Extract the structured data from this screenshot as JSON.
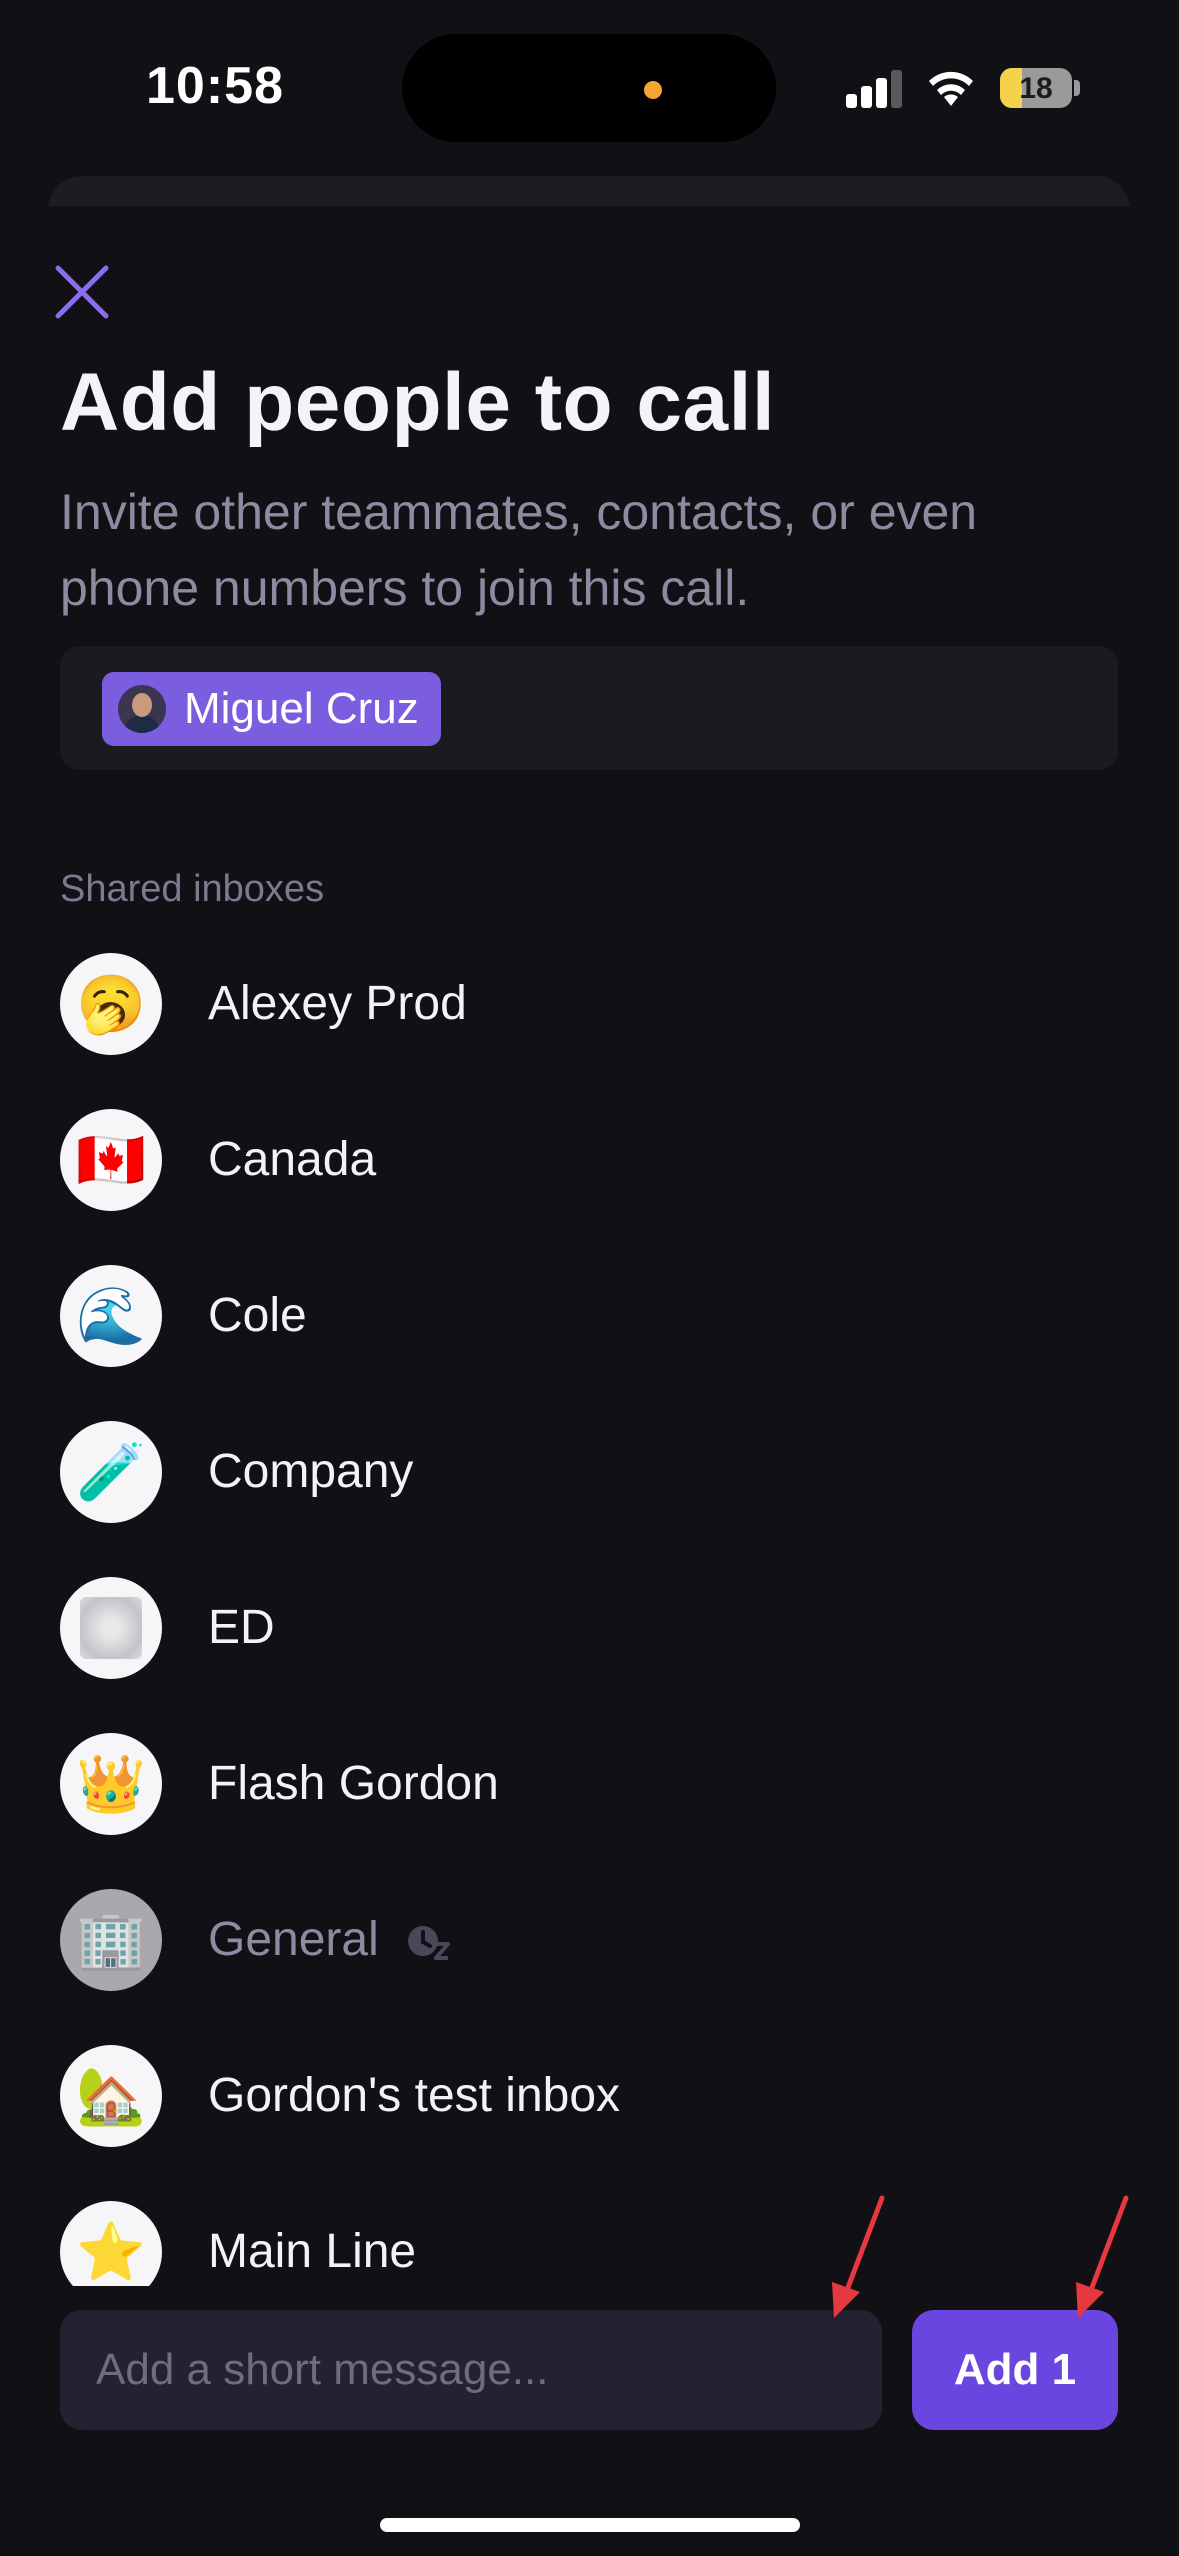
{
  "status_bar": {
    "time": "10:58",
    "battery": "18",
    "island_indicator_color": "#f6a531"
  },
  "header": {
    "close_icon": "close-icon",
    "title": "Add people to call",
    "subtitle": "Invite other teammates, contacts, or even phone numbers to join this call."
  },
  "recipients": [
    {
      "name": "Miguel Cruz"
    }
  ],
  "section": {
    "label": "Shared inboxes"
  },
  "inboxes": [
    {
      "name": "Alexey Prod",
      "emoji": "🥱",
      "muted": false
    },
    {
      "name": "Canada",
      "emoji": "🇨🇦",
      "muted": false
    },
    {
      "name": "Cole",
      "emoji": "🌊",
      "muted": false
    },
    {
      "name": "Company",
      "emoji": "🧪",
      "muted": false
    },
    {
      "name": "ED",
      "emoji": "",
      "muted": false
    },
    {
      "name": "Flash Gordon",
      "emoji": "👑",
      "muted": false
    },
    {
      "name": "General",
      "emoji": "🏢",
      "muted": true
    },
    {
      "name": "Gordon's test inbox",
      "emoji": "🏡",
      "muted": false
    },
    {
      "name": "Main Line",
      "emoji": "⭐",
      "muted": false
    }
  ],
  "composer": {
    "placeholder": "Add a short message...",
    "value": "",
    "add_button_label": "Add 1"
  },
  "colors": {
    "background": "#111015",
    "accent": "#6b45e0",
    "chip": "#7b5de0",
    "annotation_arrow": "#e5393f"
  }
}
